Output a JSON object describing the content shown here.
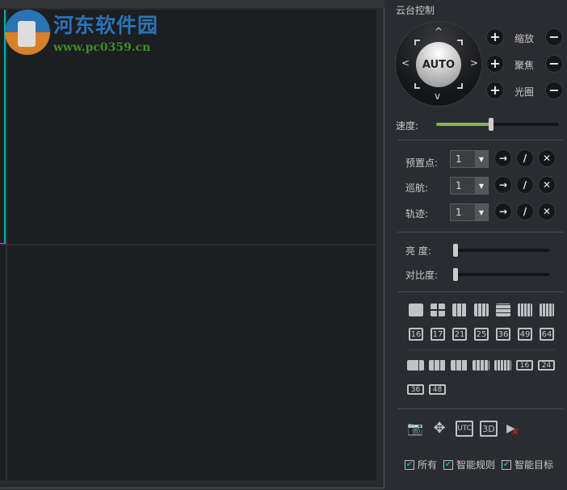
{
  "watermark": {
    "title": "河东软件园",
    "url": "www.pc0359.cn"
  },
  "panel": {
    "title": "云台控制",
    "auto_label": "AUTO",
    "lens": [
      {
        "label": "缩放"
      },
      {
        "label": "聚焦"
      },
      {
        "label": "光圈"
      }
    ],
    "plus": "+",
    "minus": "−",
    "speed": {
      "label": "速度:",
      "value_pct": 45
    },
    "presets": [
      {
        "label": "预置点:",
        "value": "1"
      },
      {
        "label": "巡航:",
        "value": "1"
      },
      {
        "label": "轨迹:",
        "value": "1"
      }
    ],
    "action_icons": {
      "go": "→",
      "edit": "/",
      "del": "✕"
    },
    "brightness": {
      "label": "亮 度:",
      "value_pct": 0
    },
    "contrast": {
      "label": "对比度:",
      "value_pct": 0
    },
    "layouts_row2": [
      "16",
      "17",
      "21",
      "25",
      "36",
      "49",
      "64"
    ],
    "layouts_row4a": [
      "16",
      "24"
    ],
    "layouts_row5": [
      "36",
      "48"
    ],
    "tools": {
      "utc": "UTC",
      "threed": "3D"
    },
    "checkboxes": [
      {
        "label": "所有",
        "checked": true
      },
      {
        "label": "智能规则",
        "checked": true
      },
      {
        "label": "智能目标",
        "checked": true
      }
    ],
    "colors": {
      "accent": "#12a6b8",
      "slider": "#8db33f"
    }
  }
}
